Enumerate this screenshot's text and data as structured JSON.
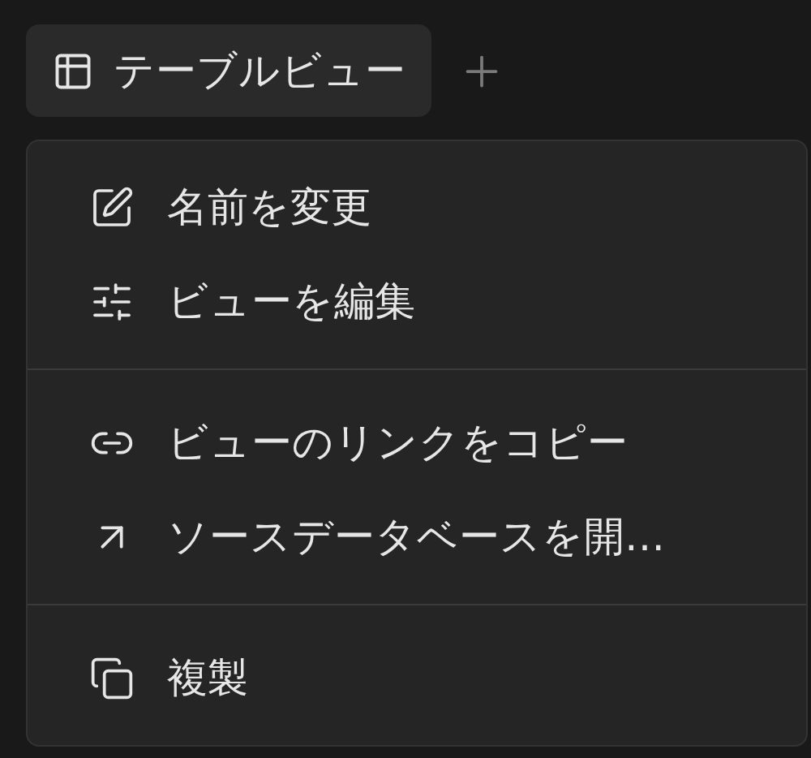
{
  "tab": {
    "label": "テーブルビュー",
    "selected": true
  },
  "menu": {
    "sections": [
      [
        {
          "kind": "rename",
          "label": "名前を変更"
        },
        {
          "kind": "edit",
          "label": "ビューを編集"
        }
      ],
      [
        {
          "kind": "link",
          "label": "ビューのリンクをコピー"
        },
        {
          "kind": "open",
          "label": "ソースデータベースを開…"
        }
      ],
      [
        {
          "kind": "duplicate",
          "label": "複製"
        }
      ]
    ]
  }
}
